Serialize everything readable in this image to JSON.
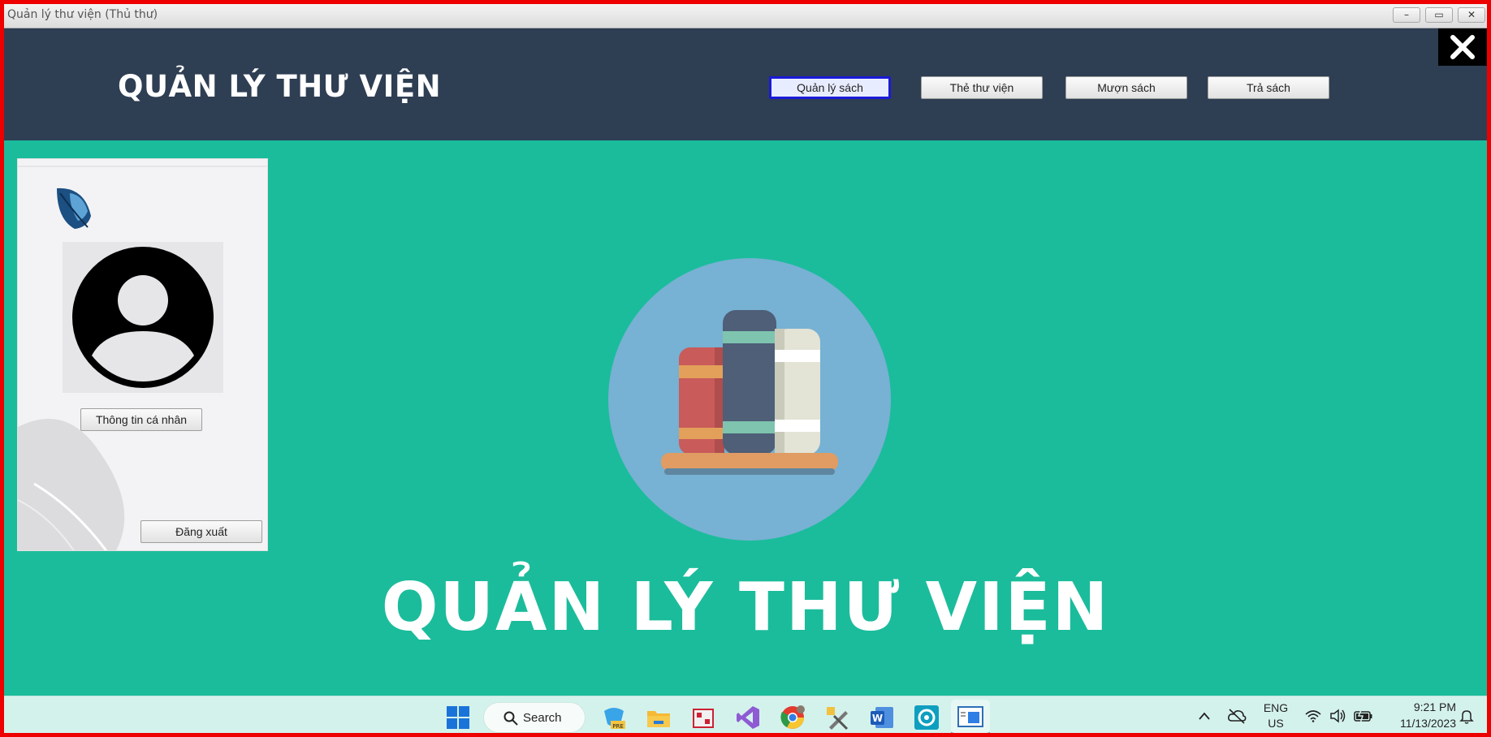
{
  "window": {
    "title": "Quản lý thư viện (Thủ thư)",
    "minimize_glyph": "–",
    "maximize_glyph": "▭",
    "close_glyph": "✕"
  },
  "header": {
    "app_title": "QUẢN LÝ THƯ VIỆN",
    "nav": [
      {
        "label": "Quản lý sách",
        "active": true
      },
      {
        "label": "Thẻ thư viện",
        "active": false
      },
      {
        "label": "Mượn sách",
        "active": false
      },
      {
        "label": "Trả sách",
        "active": false
      }
    ],
    "close_glyph": "✕"
  },
  "profile": {
    "logo_icon": "leaf-icon",
    "avatar_icon": "user-avatar-icon",
    "info_button": "Thông tin cá nhân",
    "logout_button": "Đăng xuất"
  },
  "main": {
    "illustration_icon": "books-on-shelf-icon",
    "big_title": "QUẢN LÝ THƯ VIỆN"
  },
  "taskbar": {
    "search_label": "Search",
    "language_line1": "ENG",
    "language_line2": "US",
    "time": "9:21 PM",
    "date": "11/13/2023",
    "pinned_icons": [
      "windows-start-icon",
      "copilot-pre-icon",
      "file-explorer-icon",
      "app-icon",
      "visual-studio-icon",
      "chrome-icon",
      "tools-icon",
      "word-icon",
      "settings-app-icon",
      "active-window-icon"
    ]
  },
  "colors": {
    "header_bg": "#2e3e53",
    "main_bg": "#1bbc9b",
    "active_border": "#1a1ad6",
    "frame_border": "#ee0000"
  }
}
